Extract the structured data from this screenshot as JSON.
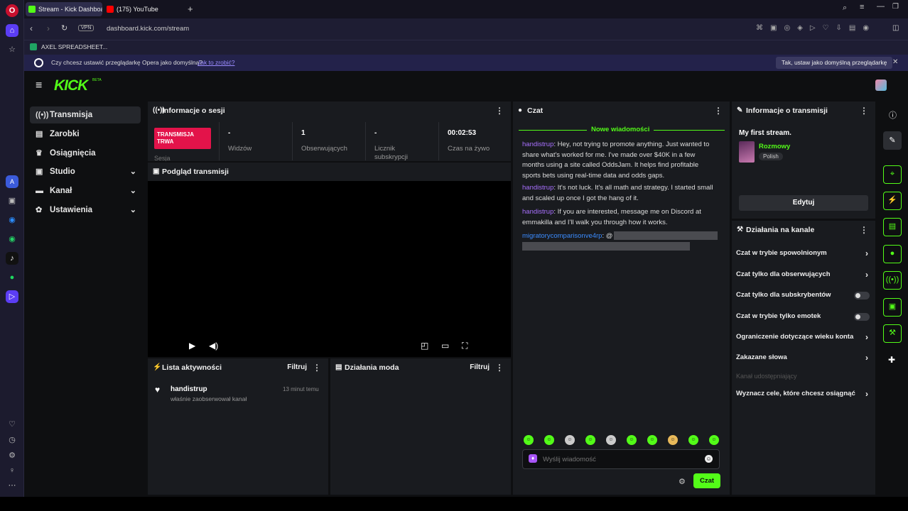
{
  "browser": {
    "tabs": [
      {
        "title": "Stream - Kick Dashboard",
        "favicon_color": "#53fc18"
      },
      {
        "title": "(175) YouTube",
        "favicon_color": "#ff0000"
      }
    ],
    "vpn_badge": "VPN",
    "url": "dashboard.kick.com/stream",
    "bookmark": "AXEL SPREADSHEET...",
    "notification": {
      "text": "Czy chcesz ustawić przeglądarkę Opera jako domyślną?",
      "link": "Jak to zrobić?",
      "button": "Tak, ustaw jako domyślną przeglądarkę"
    }
  },
  "kick": {
    "logo": "KICK",
    "logo_badge": "BETA",
    "nav": [
      {
        "label": "Transmisja",
        "icon": "broadcast-icon"
      },
      {
        "label": "Zarobki",
        "icon": "wallet-icon"
      },
      {
        "label": "Osiągnięcia",
        "icon": "trophy-icon"
      },
      {
        "label": "Studio",
        "icon": "studio-icon"
      },
      {
        "label": "Kanał",
        "icon": "channel-icon"
      },
      {
        "label": "Ustawienia",
        "icon": "gear-icon"
      }
    ],
    "session": {
      "title": "Informacje o sesji",
      "live_badge": "TRANSMISJA TRWA",
      "live_sub": "Sesja",
      "stats": [
        {
          "value": "-",
          "label": "Widzów"
        },
        {
          "value": "1",
          "label": "Obserwujących"
        },
        {
          "value": "-",
          "label": "Licznik subskrypcji"
        },
        {
          "value": "00:02:53",
          "label": "Czas na żywo"
        }
      ]
    },
    "preview": {
      "title": "Podgląd transmisji"
    },
    "activity": {
      "title": "Lista aktywności",
      "filter": "Filtruj",
      "items": [
        {
          "user": "handistrup",
          "action": "właśnie zaobserwował kanał",
          "time": "13 minut temu"
        }
      ]
    },
    "mod": {
      "title": "Działania moda",
      "filter": "Filtruj"
    },
    "chat": {
      "title": "Czat",
      "divider": "Nowe wiadomości",
      "messages": [
        {
          "user": "handistrup",
          "text": "Hey, not trying to promote anything. Just wanted to share what's worked for me. I've made over $40K in a few months using a site called OddsJam. It helps find profitable sports bets using real-time data and odds gaps."
        },
        {
          "user": "handistrup",
          "text": "It's not luck. It's all math and strategy. I started small and scaled up once I got the hang of it."
        },
        {
          "user": "handistrup",
          "text": "If you are interested, message me on Discord at emmakilla and I'll walk you through how it works."
        },
        {
          "user": "migratorycomparisonve4rp",
          "text": "@"
        }
      ],
      "input_placeholder": "Wyślij wiadomość",
      "send": "Czat",
      "accent": "#53fc18"
    },
    "stream_info": {
      "title": "Informacje o transmisji",
      "stream_title": "My first stream.",
      "category": "Rozmowy",
      "language": "Polish",
      "edit": "Edytuj"
    },
    "channel_actions": {
      "title": "Działania na kanale",
      "items": [
        {
          "label": "Czat w trybie spowolnionym",
          "kind": "chevron"
        },
        {
          "label": "Czat tylko dla obserwujących",
          "kind": "chevron"
        },
        {
          "label": "Czat tylko dla subskrybentów",
          "kind": "toggle"
        },
        {
          "label": "Czat w trybie tylko emotek",
          "kind": "toggle"
        },
        {
          "label": "Ograniczenie dotyczące wieku konta",
          "kind": "chevron"
        },
        {
          "label": "Zakazane słowa",
          "kind": "chevron"
        }
      ],
      "section_label": "Kanał udostępniający",
      "goals": "Wyznacz cele, które chcesz osiągnąć"
    }
  }
}
